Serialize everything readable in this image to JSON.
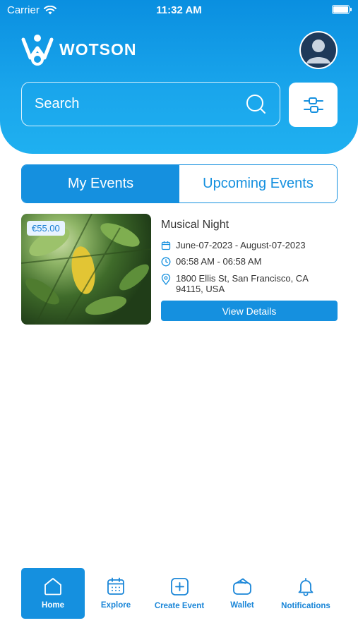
{
  "status_bar": {
    "carrier": "Carrier",
    "time": "11:32 AM"
  },
  "brand": {
    "name": "WOTSON"
  },
  "search": {
    "placeholder": "Search"
  },
  "tabs": [
    {
      "label": "My Events",
      "active": true
    },
    {
      "label": "Upcoming Events",
      "active": false
    }
  ],
  "event": {
    "price": "€55.00",
    "title": "Musical Night",
    "date": "June-07-2023 - August-07-2023",
    "time": "06:58 AM - 06:58 AM",
    "address": "1800 Ellis St, San Francisco, CA 94115, USA",
    "button_label": "View Details"
  },
  "bottom_nav": [
    {
      "label": "Home",
      "icon": "home-icon",
      "active": true
    },
    {
      "label": "Explore",
      "icon": "calendar-icon",
      "active": false
    },
    {
      "label": "Create Event",
      "icon": "plus-square-icon",
      "active": false
    },
    {
      "label": "Wallet",
      "icon": "wallet-icon",
      "active": false
    },
    {
      "label": "Notifications",
      "icon": "bell-icon",
      "active": false
    }
  ],
  "colors": {
    "primary": "#1590df",
    "header_gradient_start": "#0a8fe0",
    "header_gradient_end": "#1fb0f0",
    "avatar_bg": "#1f3a5a"
  }
}
